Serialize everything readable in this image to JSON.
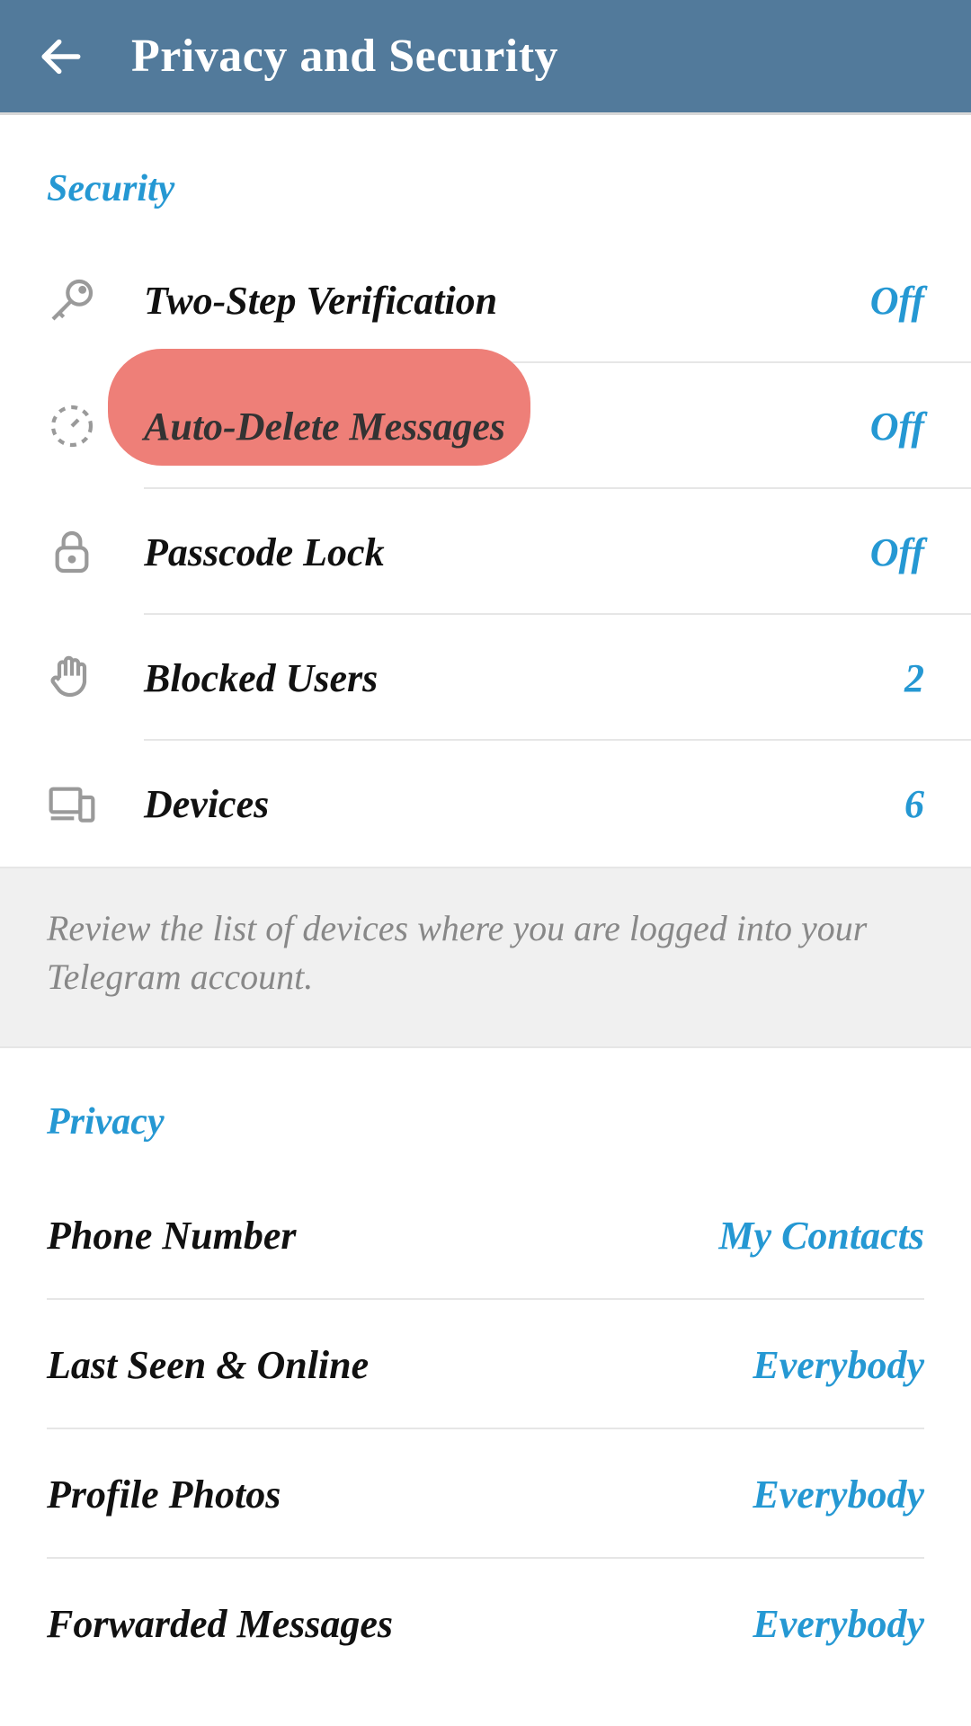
{
  "header": {
    "title": "Privacy and Security"
  },
  "sections": {
    "security": {
      "title": "Security",
      "items": [
        {
          "label": "Two-Step Verification",
          "value": "Off"
        },
        {
          "label": "Auto-Delete Messages",
          "value": "Off"
        },
        {
          "label": "Passcode Lock",
          "value": "Off"
        },
        {
          "label": "Blocked Users",
          "value": "2"
        },
        {
          "label": "Devices",
          "value": "6"
        }
      ],
      "description": "Review the list of devices where you are logged into your Telegram account."
    },
    "privacy": {
      "title": "Privacy",
      "items": [
        {
          "label": "Phone Number",
          "value": "My Contacts"
        },
        {
          "label": "Last Seen & Online",
          "value": "Everybody"
        },
        {
          "label": "Profile Photos",
          "value": "Everybody"
        },
        {
          "label": "Forwarded Messages",
          "value": "Everybody"
        }
      ]
    }
  }
}
